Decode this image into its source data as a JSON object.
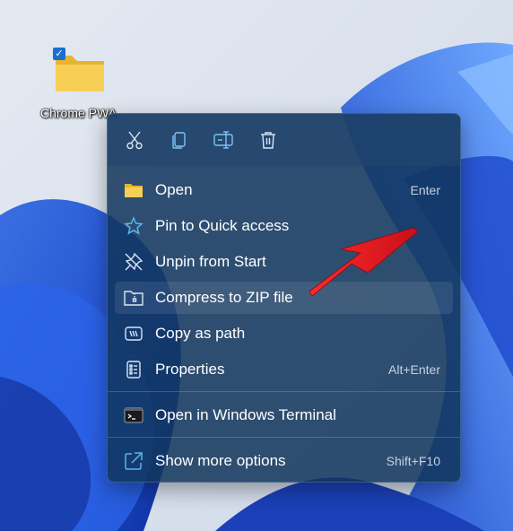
{
  "desktop": {
    "icon_label": "Chrome PWA",
    "selected": true
  },
  "toolbar": {
    "buttons": [
      {
        "name": "cut",
        "icon": "scissors-icon"
      },
      {
        "name": "copy",
        "icon": "copy-icon"
      },
      {
        "name": "rename",
        "icon": "rename-icon"
      },
      {
        "name": "delete",
        "icon": "trash-icon"
      }
    ]
  },
  "menu": {
    "items": [
      {
        "label": "Open",
        "shortcut": "Enter",
        "icon": "folder-icon"
      },
      {
        "label": "Pin to Quick access",
        "shortcut": "",
        "icon": "star-icon"
      },
      {
        "label": "Unpin from Start",
        "shortcut": "",
        "icon": "unpin-icon"
      },
      {
        "label": "Compress to ZIP file",
        "shortcut": "",
        "icon": "zip-icon",
        "highlighted": true
      },
      {
        "label": "Copy as path",
        "shortcut": "",
        "icon": "copy-path-icon"
      },
      {
        "label": "Properties",
        "shortcut": "Alt+Enter",
        "icon": "properties-icon"
      },
      {
        "label": "Open in Windows Terminal",
        "shortcut": "",
        "icon": "terminal-icon"
      },
      {
        "label": "Show more options",
        "shortcut": "Shift+F10",
        "icon": "more-options-icon"
      }
    ]
  },
  "colors": {
    "menu_bg": "#12365c",
    "accent_blue": "#1b6fd1",
    "icon_blue": "#5ab4f0",
    "folder_yellow": "#f6c642",
    "arrow_red": "#e8141e"
  }
}
